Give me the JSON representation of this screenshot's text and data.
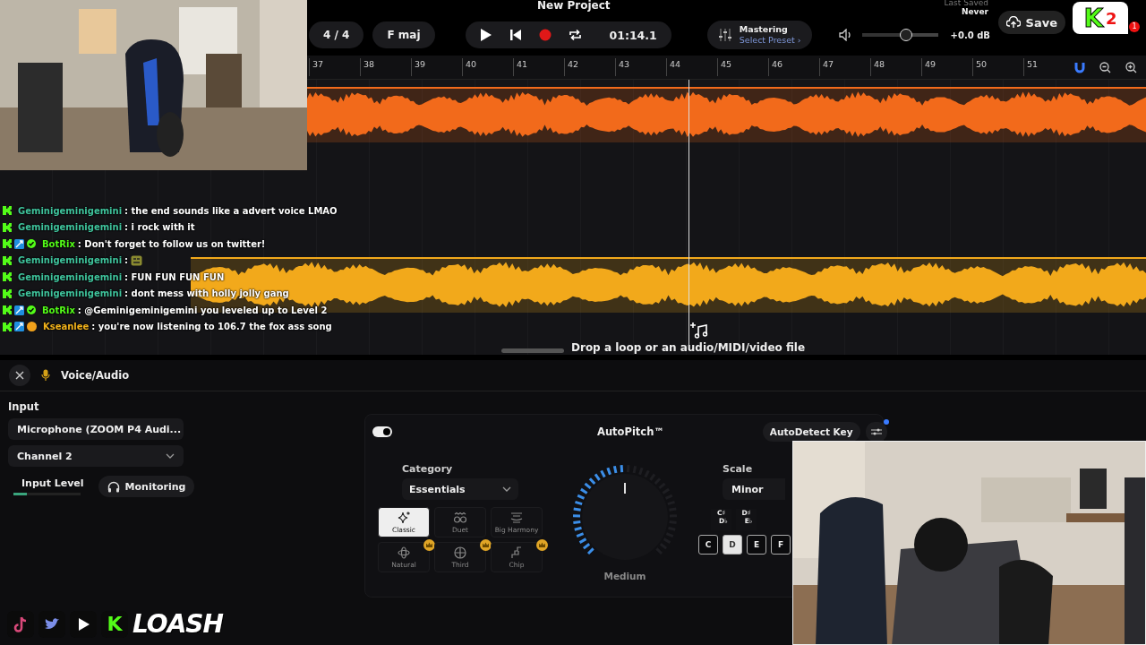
{
  "window": {
    "title": "New Project"
  },
  "transport": {
    "time_signature": "4 / 4",
    "key": "F maj",
    "playing": false,
    "recording": false,
    "loop": true,
    "time": "01:14.1"
  },
  "mastering": {
    "title": "Mastering",
    "preset": "Select Preset ›"
  },
  "volume": {
    "level": 0.58,
    "reading": "+0.0 dB"
  },
  "save_status": {
    "label": "Last Saved",
    "value": "Never"
  },
  "save_button": "Save",
  "notifications": {
    "count": "1"
  },
  "ruler": [
    "37",
    "38",
    "39",
    "40",
    "41",
    "42",
    "43",
    "44",
    "45",
    "46",
    "47",
    "48",
    "49",
    "50",
    "51"
  ],
  "tracks": [
    {
      "kind": "orange",
      "color": "#f26a1b"
    },
    {
      "kind": "yellow",
      "color": "#f2a91b"
    }
  ],
  "drop_hint": "Drop a loop or an audio/MIDI/video file",
  "chat": [
    {
      "user": "Geminigeminigemini",
      "color": "#3fc39c",
      "badges": [
        {
          "kind": "kick"
        }
      ],
      "text": ": the end sounds like a advert voice LMAO"
    },
    {
      "user": "Geminigeminigemini",
      "color": "#3fc39c",
      "badges": [
        {
          "kind": "kick"
        }
      ],
      "text": ": i rock with it"
    },
    {
      "user": "BotRix",
      "color": "#53fc18",
      "badges": [
        {
          "kind": "kick"
        },
        {
          "kind": "mod"
        },
        {
          "kind": "verified"
        }
      ],
      "text": ": Don't forget to follow us on twitter!"
    },
    {
      "user": "Geminigeminigemini",
      "color": "#3fc39c",
      "badges": [
        {
          "kind": "kick"
        }
      ],
      "text": ": ",
      "emote": true
    },
    {
      "user": "Geminigeminigemini",
      "color": "#3fc39c",
      "badges": [
        {
          "kind": "kick"
        }
      ],
      "text": ": FUN FUN FUN FUN"
    },
    {
      "user": "Geminigeminigemini",
      "color": "#3fc39c",
      "badges": [
        {
          "kind": "kick"
        }
      ],
      "text": ": dont mess with holly jolly gang"
    },
    {
      "user": "BotRix",
      "color": "#53fc18",
      "badges": [
        {
          "kind": "kick"
        },
        {
          "kind": "mod"
        },
        {
          "kind": "verified"
        }
      ],
      "text": ": @Geminigeminigemini you leveled up to Level 2"
    },
    {
      "user": "Kseanlee",
      "color": "#f2b21b",
      "badges": [
        {
          "kind": "kick"
        },
        {
          "kind": "mod"
        },
        {
          "kind": "sub"
        }
      ],
      "text": ": you're now listening to 106.7 the fox ass song"
    }
  ],
  "panel": {
    "title": "Voice/Audio",
    "input_label": "Input",
    "device": "Microphone (ZOOM P4 Audi...",
    "channel": "Channel 2",
    "input_level": {
      "label": "Input Level",
      "level": 0.2
    },
    "monitoring": "Monitoring"
  },
  "autopitch": {
    "on": true,
    "title": "AutoPitch™",
    "autodetect": "AutoDetect Key",
    "settings_dot": true,
    "category": {
      "label": "Category",
      "value": "Essentials"
    },
    "presets": [
      {
        "label": "Classic",
        "kind": "sparkle",
        "selected": true,
        "premium": false
      },
      {
        "label": "Duet",
        "kind": "duet",
        "selected": false,
        "premium": false
      },
      {
        "label": "Big Harmony",
        "kind": "harmony",
        "selected": false,
        "premium": false
      },
      {
        "label": "Natural",
        "kind": "atom",
        "selected": false,
        "premium": true
      },
      {
        "label": "Third",
        "kind": "globe",
        "selected": false,
        "premium": true
      },
      {
        "label": "Chip",
        "kind": "chip",
        "selected": false,
        "premium": true
      }
    ],
    "amount": {
      "level": 0.5,
      "label": "Medium"
    },
    "scale": {
      "label": "Scale",
      "value": "Minor"
    },
    "sharps": [
      {
        "top": "C♯",
        "bottom": "D♭"
      },
      {
        "top": "D♯",
        "bottom": "E♭"
      }
    ],
    "notes": [
      {
        "label": "C",
        "selected": false
      },
      {
        "label": "D",
        "selected": true
      },
      {
        "label": "E",
        "selected": false
      },
      {
        "label": "F",
        "selected": false
      }
    ]
  },
  "overlay_logo": {
    "mark": "K",
    "suffix": "2"
  },
  "socials": {
    "kick": "K",
    "name": "LOASH"
  }
}
